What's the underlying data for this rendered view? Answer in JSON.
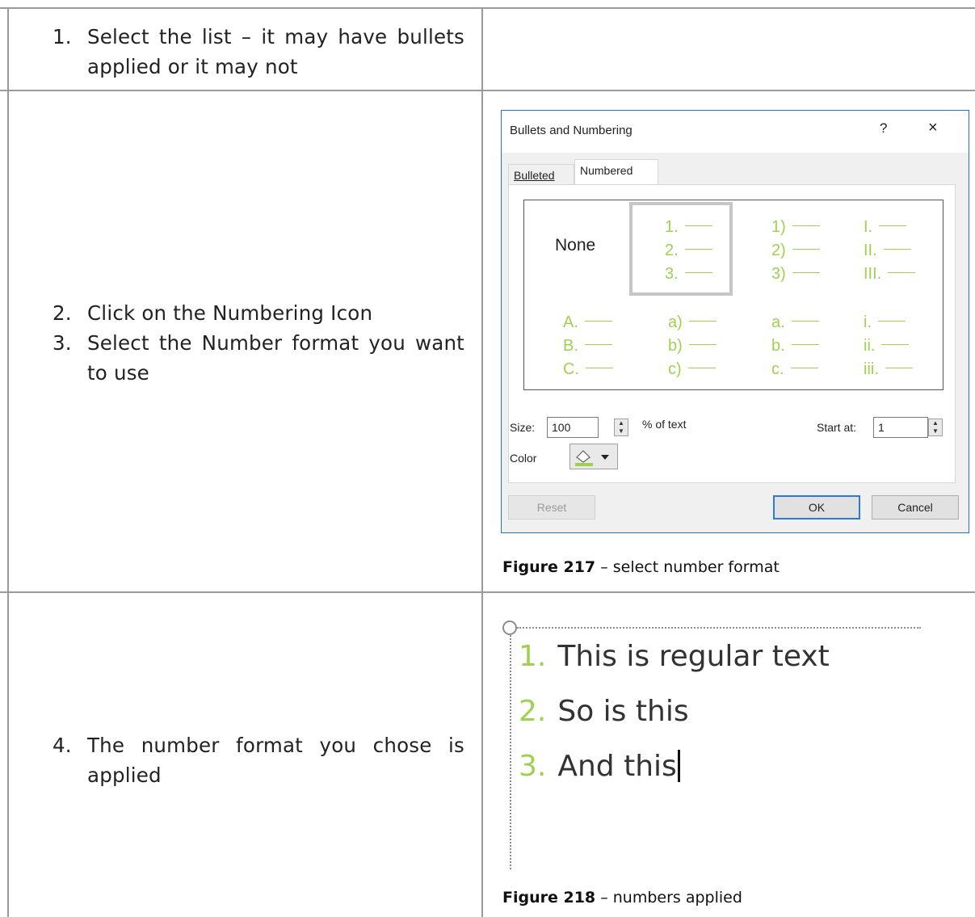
{
  "steps": {
    "row1": [
      {
        "num": "1.",
        "text": "Select the list – it may have bullets applied or it may not"
      }
    ],
    "row2": [
      {
        "num": "2.",
        "text": "Click on the Numbering Icon"
      },
      {
        "num": "3.",
        "text": "Select the Number format you want to use"
      }
    ],
    "row3": [
      {
        "num": "4.",
        "text": "The number format you chose is applied"
      }
    ]
  },
  "dialog": {
    "title": "Bullets and Numbering",
    "help": "?",
    "close": "×",
    "tabs": [
      "Bulleted",
      "Numbered"
    ],
    "none_label": "None",
    "formats": [
      [
        "1.",
        "2.",
        "3."
      ],
      [
        "1)",
        "2)",
        "3)"
      ],
      [
        "I.",
        "II.",
        "III."
      ],
      [
        "A.",
        "B.",
        "C."
      ],
      [
        "a)",
        "b)",
        "c)"
      ],
      [
        "a.",
        "b.",
        "c."
      ],
      [
        "i.",
        "ii.",
        "iii."
      ]
    ],
    "size_label": "Size:",
    "size_value": "100",
    "size_suffix": "% of text",
    "start_label": "Start at:",
    "start_value": "1",
    "color_label": "Color",
    "reset": "Reset",
    "ok": "OK",
    "cancel": "Cancel",
    "accent": "#9fd150"
  },
  "captions": {
    "fig217_label": "Figure 217",
    "fig217_text": " – select number format",
    "fig218_label": "Figure 218",
    "fig218_text": " – numbers applied"
  },
  "applied_list": [
    {
      "num": "1.",
      "text": "This is regular text"
    },
    {
      "num": "2.",
      "text": "So is this"
    },
    {
      "num": "3.",
      "text": "And this"
    }
  ]
}
